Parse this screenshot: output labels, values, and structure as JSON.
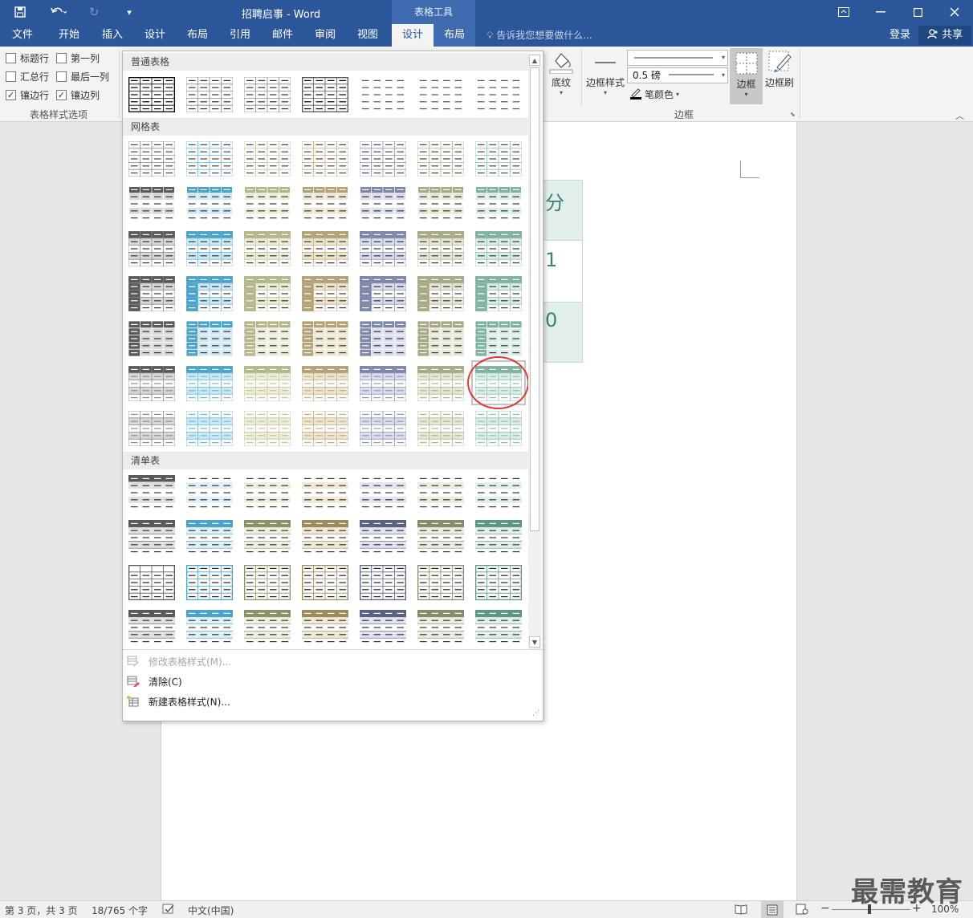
{
  "window": {
    "title": "招聘启事 - Word",
    "tool_header": "表格工具"
  },
  "tabs": [
    "文件",
    "开始",
    "插入",
    "设计",
    "布局",
    "引用",
    "邮件",
    "审阅",
    "视图",
    "设计",
    "布局"
  ],
  "tell_me": "告诉我您想要做什么...",
  "login": "登录",
  "share": "共享",
  "ribbon": {
    "style_options": {
      "header_row": "标题行",
      "first_column": "第一列",
      "total_row": "汇总行",
      "last_column": "最后一列",
      "banded_rows": "镶边行",
      "banded_columns": "镶边列",
      "group_label": "表格样式选项",
      "checked": {
        "header_row": false,
        "first_column": false,
        "total_row": false,
        "last_column": false,
        "banded_rows": true,
        "banded_columns": true
      }
    },
    "shading": "底纹",
    "border_styles": "边框样式",
    "pen_weight": "0.5 磅",
    "pen_color": "笔颜色",
    "borders": "边框",
    "border_painter": "边框刷",
    "borders_group_label": "边框"
  },
  "gallery": {
    "categories": [
      "普通表格",
      "网格表",
      "清单表"
    ],
    "plain_thumbs": [
      {
        "kind": "full",
        "stroke": "#000000",
        "fill": "#ffffff"
      },
      {
        "kind": "grid",
        "stroke": "#8a8a8a",
        "fill": "#ffffff"
      },
      {
        "kind": "grid",
        "stroke": "#8a8a8a",
        "fill": "#ffffff"
      },
      {
        "kind": "full",
        "stroke": "#555555",
        "fill": "#ffffff"
      },
      {
        "kind": "plain",
        "stroke": "#555555",
        "fill": "#ffffff"
      },
      {
        "kind": "plain",
        "stroke": "#555555",
        "fill": "#ffffff"
      },
      {
        "kind": "plain",
        "stroke": "#555555",
        "fill": "#ffffff"
      }
    ],
    "grid_colors": [
      {
        "dark": "#5a5a5a",
        "light": "#d9d9d9",
        "line": "#8a8a8a"
      },
      {
        "dark": "#4aa3c8",
        "light": "#cfe9f4",
        "line": "#6cb7d6"
      },
      {
        "dark": "#b5b58a",
        "light": "#ededda",
        "line": "#c2c29a"
      },
      {
        "dark": "#b3a276",
        "light": "#ede6d0",
        "line": "#bfae85"
      },
      {
        "dark": "#7f86a8",
        "light": "#dadeed",
        "line": "#8e95b5"
      },
      {
        "dark": "#a9a986",
        "light": "#e7e7d7",
        "line": "#b2b292"
      },
      {
        "dark": "#7fb3a0",
        "light": "#dcede6",
        "line": "#8fbfae"
      }
    ],
    "list_colors": [
      {
        "dark": "#5a5a5a",
        "light": "#e0e0e0",
        "line": "#5a5a5a"
      },
      {
        "dark": "#4aa3c8",
        "light": "#dff0f7",
        "line": "#4aa3c8"
      },
      {
        "dark": "#8f8f6a",
        "light": "#efefe0",
        "line": "#8f8f6a"
      },
      {
        "dark": "#9a8a5c",
        "light": "#efe9d6",
        "line": "#9a8a5c"
      },
      {
        "dark": "#5a6282",
        "light": "#e1e3ee",
        "line": "#5a6282"
      },
      {
        "dark": "#8a8a6a",
        "light": "#ebebde",
        "line": "#8a8a6a"
      },
      {
        "dark": "#5e9684",
        "light": "#e1efe9",
        "line": "#5e9684"
      }
    ],
    "selected": {
      "row": 5,
      "col": 6
    }
  },
  "gallery_menu": {
    "modify": "修改表格样式(M)...",
    "clear": "清除(C)",
    "new_style": "新建表格样式(N)..."
  },
  "document": {
    "cells": [
      "分",
      "1",
      "0"
    ]
  },
  "status": {
    "page": "第 3 页，共 3 页",
    "words": "18/765 个字",
    "language": "中文(中国)",
    "zoom": "100%"
  },
  "watermark": "最需教育"
}
